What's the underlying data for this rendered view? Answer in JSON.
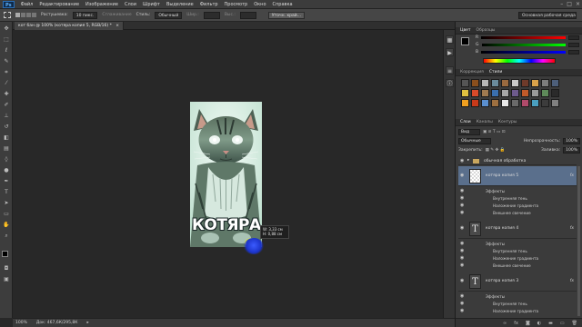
{
  "menu": {
    "logo": "Ps",
    "items": [
      "Файл",
      "Редактирование",
      "Изображение",
      "Слои",
      "Шрифт",
      "Выделение",
      "Фильтр",
      "Просмотр",
      "Окно",
      "Справка"
    ],
    "window_controls": [
      "–",
      "□",
      "×"
    ]
  },
  "options_bar": {
    "feather_label": "Растушевка:",
    "feather_value": "10 пикс.",
    "smoothing_label": "Сглаживание",
    "style_label": "Стиль:",
    "style_value": "Обычный",
    "width_label": "Шир.:",
    "height_label": "Выс.:",
    "refine_button": "Уточн. край...",
    "workspace_value": "Основная рабочая среда"
  },
  "document_tab": {
    "title": "кот бан @ 100% (котяра копия 5, RGB/16) *",
    "close": "×"
  },
  "canvas": {
    "title_text": "КОТЯРА",
    "measure_w": "W: 3,33 см",
    "measure_h": "H: 0,88 см"
  },
  "status": {
    "zoom": "100%",
    "doc_info": "Док: 467,6К/295,8К"
  },
  "color_panel": {
    "tabs": [
      "Цвет",
      "Образцы"
    ],
    "channels": [
      "R",
      "G",
      "B"
    ],
    "colors": {
      "fg": "#000000",
      "bg": "#ffffff"
    }
  },
  "styles_panel": {
    "tabs": [
      "Коррекция",
      "Стили"
    ],
    "swatch_colors": [
      "#555555",
      "#8a4f1d",
      "#b8b8b8",
      "#6a8b9c",
      "#9a6a3f",
      "#c9c9c9",
      "#6e3a2a",
      "#d9a24a",
      "#7d7d7d",
      "#4d5f7a",
      "#e0c040",
      "#d84a2a",
      "#a07a50",
      "#3a6fae",
      "#a8a8a8",
      "#6d5a8c",
      "#c05a2a",
      "#9a9a9a",
      "#5e8a5a",
      "#2a2a2a",
      "#f0a020",
      "#c83a1a",
      "#5a8fcf",
      "#9e7040",
      "#e8e8e8",
      "#6a6a6a",
      "#b04a6a",
      "#4aa0c0",
      "#3c3c3c",
      "#808080"
    ]
  },
  "layers_panel": {
    "tabs": [
      "Слои",
      "Каналы",
      "Контуры"
    ],
    "kind_label": "Вид",
    "blend_mode": "Обычные",
    "opacity_label": "Непрозрачность:",
    "opacity_value": "100%",
    "lock_label": "Закрепить:",
    "fill_label": "Заливка:",
    "fill_value": "100%",
    "group_name": "обычная обработка",
    "layers": [
      {
        "name": "котяра копия 5",
        "type": "raster",
        "fx": "fx",
        "selected": true,
        "effects_label": "Эффекты",
        "effects": [
          "Внутренняя тень",
          "Наложение градиента",
          "Внешнее свечение"
        ]
      },
      {
        "name": "котяра копия 4",
        "type": "text",
        "fx": "fx",
        "selected": false,
        "effects_label": "Эффекты",
        "effects": [
          "Внутренняя тень",
          "Наложение градиента",
          "Внешнее свечение"
        ]
      },
      {
        "name": "котяра копия 3",
        "type": "text",
        "fx": "fx",
        "selected": false,
        "effects_label": "Эффекты",
        "effects": [
          "Внутренняя тень",
          "Наложение градиента"
        ]
      }
    ]
  }
}
